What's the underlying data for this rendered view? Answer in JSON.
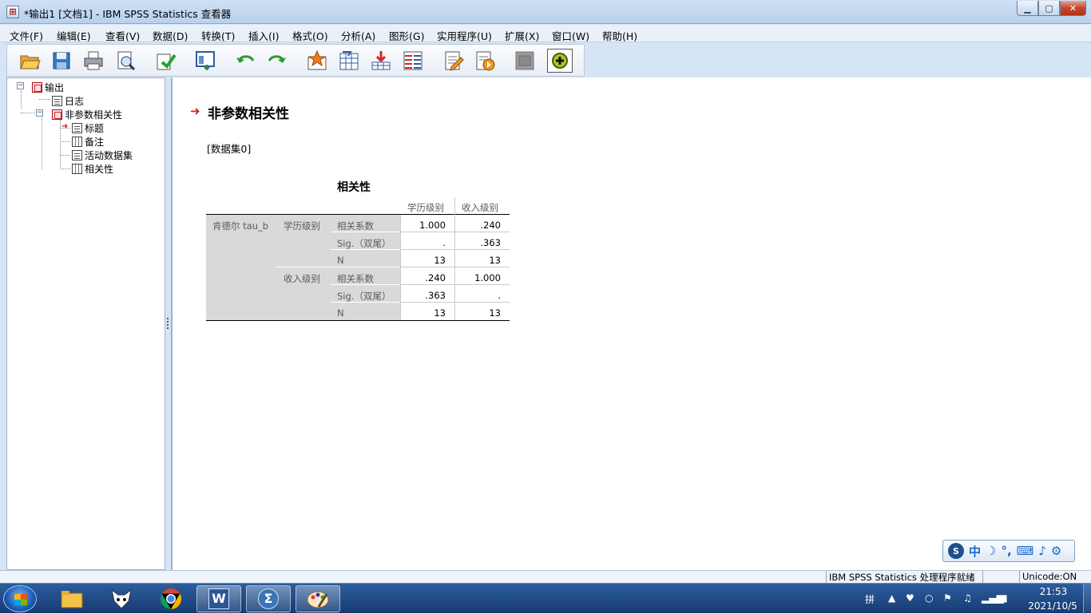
{
  "window": {
    "title": "*输出1 [文档1] - IBM SPSS Statistics 查看器",
    "app_icon": "spss-viewer-icon"
  },
  "menu": [
    "文件(F)",
    "编辑(E)",
    "查看(V)",
    "数据(D)",
    "转换(T)",
    "插入(I)",
    "格式(O)",
    "分析(A)",
    "图形(G)",
    "实用程序(U)",
    "扩展(X)",
    "窗口(W)",
    "帮助(H)"
  ],
  "toolbar": [
    {
      "icon": "open-folder-icon"
    },
    {
      "icon": "save-icon"
    },
    {
      "icon": "print-icon"
    },
    {
      "icon": "print-preview-icon"
    },
    {
      "icon": "export-icon"
    },
    {
      "icon": "recall-dialog-icon"
    },
    {
      "icon": "undo-icon"
    },
    {
      "icon": "redo-icon"
    },
    {
      "icon": "goto-data-icon"
    },
    {
      "icon": "goto-case-icon"
    },
    {
      "icon": "insert-output-icon"
    },
    {
      "icon": "variables-icon"
    },
    {
      "icon": "insert-title-icon"
    },
    {
      "icon": "insert-text-icon"
    },
    {
      "icon": "hide-output-icon"
    },
    {
      "icon": "designate-window-icon"
    }
  ],
  "outline": {
    "root": "输出",
    "log": "日志",
    "procedure": "非参数相关性",
    "children": [
      "标题",
      "备注",
      "活动数据集",
      "相关性"
    ]
  },
  "content": {
    "heading": "非参数相关性",
    "dataset": "[数据集0]",
    "table": {
      "title": "相关性",
      "col_headers": [
        "学历级别",
        "收入级别"
      ],
      "method": "肯德尔 tau_b",
      "groups": [
        {
          "var": "学历级别",
          "rows": [
            {
              "stat": "相关系数",
              "v1": "1.000",
              "v2": ".240"
            },
            {
              "stat": "Sig.（双尾）",
              "v1": ".",
              "v2": ".363"
            },
            {
              "stat": "N",
              "v1": "13",
              "v2": "13"
            }
          ]
        },
        {
          "var": "收入级别",
          "rows": [
            {
              "stat": "相关系数",
              "v1": ".240",
              "v2": "1.000"
            },
            {
              "stat": "Sig.（双尾）",
              "v1": ".363",
              "v2": "."
            },
            {
              "stat": "N",
              "v1": "13",
              "v2": "13"
            }
          ]
        }
      ]
    }
  },
  "statusbar": {
    "processor": "IBM SPSS Statistics 处理程序就绪",
    "unicode": "Unicode:ON"
  },
  "ime": {
    "mode": "中"
  },
  "taskbar": {
    "apps": [
      "file-explorer-icon",
      "foxmail-icon",
      "chrome-icon",
      "word-icon",
      "spss-icon",
      "paint-icon"
    ],
    "word_glyph": "W",
    "spss_glyph": "Σ",
    "clock_time": "21:53",
    "clock_date": "2021/10/5"
  }
}
